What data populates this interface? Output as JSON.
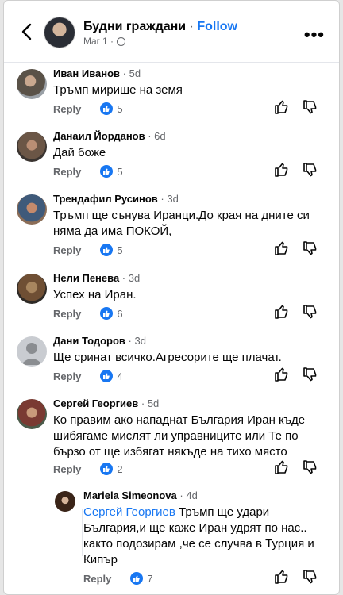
{
  "header": {
    "page_name": "Будни граждани",
    "separator": " · ",
    "follow_label": "Follow",
    "date": "Mar 1 ·",
    "more_label": "•••"
  },
  "reply_label": "Reply",
  "comments": [
    {
      "author": "Иван Иванов",
      "time": " · 5d",
      "text": "Тръмп мирише на земя",
      "likes": "5"
    },
    {
      "author": "Данаил Йорданов",
      "time": " · 6d",
      "text": "Дай боже",
      "likes": "5"
    },
    {
      "author": "Трендафил Русинов",
      "time": " · 3d",
      "text": "Тръмп ще сънува Иранци.До края на дните си няма да има ПОКОЙ,",
      "likes": "5"
    },
    {
      "author": "Нели Пенева",
      "time": " · 3d",
      "text": "Успех на Иран.",
      "likes": "6"
    },
    {
      "author": "Дани Тодоров",
      "time": " · 3d",
      "text": "Ще сринат всичко.Агресорите ще плачат.",
      "likes": "4"
    },
    {
      "author": "Сергей Георгиев",
      "time": " · 5d",
      "text": "Ко правим ако нападнат България Иран къде шибягаме мислят ли управниците или Те по бързо от ще избягат някъде на тихо място",
      "likes": "2"
    }
  ],
  "reply_comment": {
    "author": "Mariela Simeonova",
    "time": " · 4d",
    "mention": "Сергей Георгиев",
    "text": " Тръмп ще удари България,и ще каже Иран удрят по нас.. както подозирам ,че се случва в Турция и Кипър",
    "likes": "7"
  }
}
